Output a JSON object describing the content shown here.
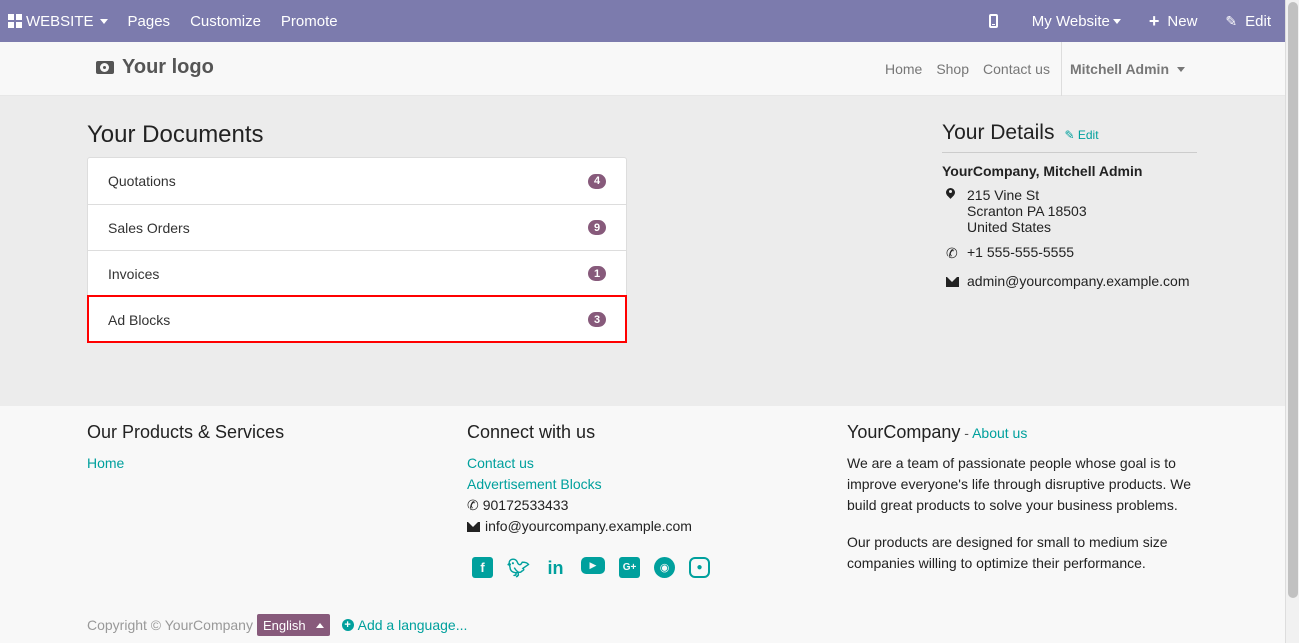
{
  "adminbar": {
    "website_label": "WEBSITE",
    "pages": "Pages",
    "customize": "Customize",
    "promote": "Promote",
    "my_website": "My Website",
    "new": "New",
    "edit": "Edit"
  },
  "header": {
    "logo_text": "Your logo",
    "nav": [
      "Home",
      "Shop",
      "Contact us"
    ],
    "user": "Mitchell Admin"
  },
  "documents": {
    "title": "Your Documents",
    "items": [
      {
        "label": "Quotations",
        "count": "4"
      },
      {
        "label": "Sales Orders",
        "count": "9"
      },
      {
        "label": "Invoices",
        "count": "1"
      },
      {
        "label": "Ad Blocks",
        "count": "3"
      }
    ]
  },
  "details": {
    "title": "Your Details",
    "edit": "Edit",
    "company": "YourCompany, Mitchell Admin",
    "address_line1": "215 Vine St",
    "address_line2": "Scranton PA 18503",
    "address_line3": "United States",
    "phone": "+1 555-555-5555",
    "email": "admin@yourcompany.example.com"
  },
  "footer": {
    "products_title": "Our Products & Services",
    "products_links": [
      "Home"
    ],
    "connect_title": "Connect with us",
    "connect_links": [
      "Contact us",
      "Advertisement Blocks"
    ],
    "connect_phone": "90172533433",
    "connect_email": "info@yourcompany.example.com",
    "social_icons": [
      "facebook-icon",
      "twitter-icon",
      "linkedin-icon",
      "youtube-icon",
      "google-plus-icon",
      "github-icon",
      "instagram-icon"
    ],
    "about_company": "YourCompany",
    "about_sep": " - ",
    "about_link": "About us",
    "about_p1": "We are a team of passionate people whose goal is to improve everyone's life through disruptive products. We build great products to solve your business problems.",
    "about_p2": "Our products are designed for small to medium size companies willing to optimize their performance.",
    "copyright": "Copyright © YourCompany",
    "language": "English",
    "add_language": "Add a language..."
  },
  "colors": {
    "adminbar": "#7C7BAD",
    "accent": "#00A09D",
    "badge": "#875A7B",
    "highlight": "#ff0000"
  }
}
